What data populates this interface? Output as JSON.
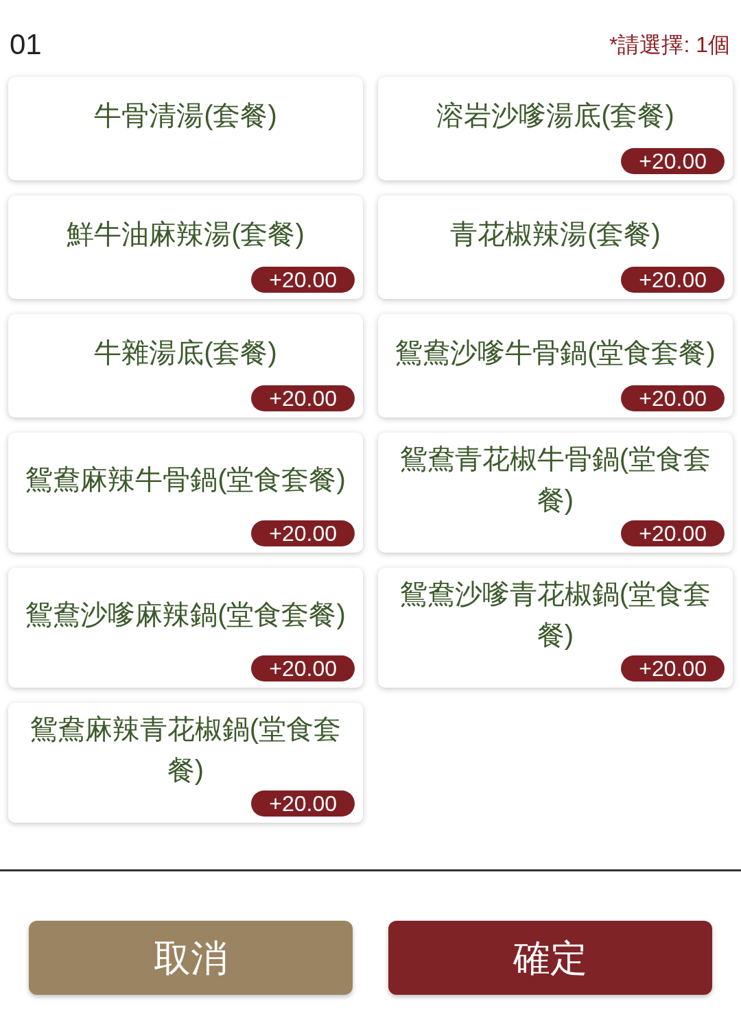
{
  "header": {
    "step": "01",
    "requirement": "*請選擇: 1個"
  },
  "options": [
    {
      "name": "牛骨清湯(套餐)"
    },
    {
      "name": "溶岩沙嗲湯底(套餐)",
      "price": "+20.00"
    },
    {
      "name": "鮮牛油麻辣湯(套餐)",
      "price": "+20.00"
    },
    {
      "name": "青花椒辣湯(套餐)",
      "price": "+20.00"
    },
    {
      "name": "牛雜湯底(套餐)",
      "price": "+20.00"
    },
    {
      "name": "鴛鴦沙嗲牛骨鍋(堂食套餐)",
      "price": "+20.00"
    },
    {
      "name": "鴛鴦麻辣牛骨鍋(堂食套餐)",
      "price": "+20.00"
    },
    {
      "name": "鴛鴦青花椒牛骨鍋(堂食套餐)",
      "price": "+20.00"
    },
    {
      "name": "鴛鴦沙嗲麻辣鍋(堂食套餐)",
      "price": "+20.00"
    },
    {
      "name": "鴛鴦沙嗲青花椒鍋(堂食套餐)",
      "price": "+20.00"
    },
    {
      "name": "鴛鴦麻辣青花椒鍋(堂食套餐)",
      "price": "+20.00"
    }
  ],
  "buttons": [
    {
      "label": "取消",
      "kind": "cancel"
    },
    {
      "label": "確定",
      "kind": "confirm"
    }
  ]
}
